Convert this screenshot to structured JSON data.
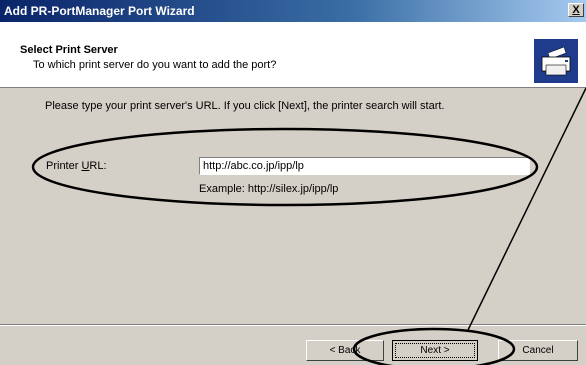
{
  "window": {
    "title": "Add PR-PortManager Port Wizard",
    "close_label": "X"
  },
  "header": {
    "title": "Select Print Server",
    "subtitle": "To which print server do you want to add the port?",
    "icon": "printer-wizard-icon"
  },
  "main": {
    "instruction": "Please type your print server's URL. If you click [Next], the printer search will start.",
    "printer_url_label_pre": "Printer ",
    "printer_url_label_accel": "U",
    "printer_url_label_post": "RL:",
    "printer_url_value": "http://abc.co.jp/ipp/lp",
    "example": "Example: http://silex.jp/ipp/lp"
  },
  "buttons": {
    "back": "< Back",
    "next": "Next >",
    "cancel": "Cancel"
  },
  "colors": {
    "titlebar_start": "#0a246a",
    "titlebar_end": "#a6caf0",
    "dialog_face": "#d4d0c8"
  }
}
